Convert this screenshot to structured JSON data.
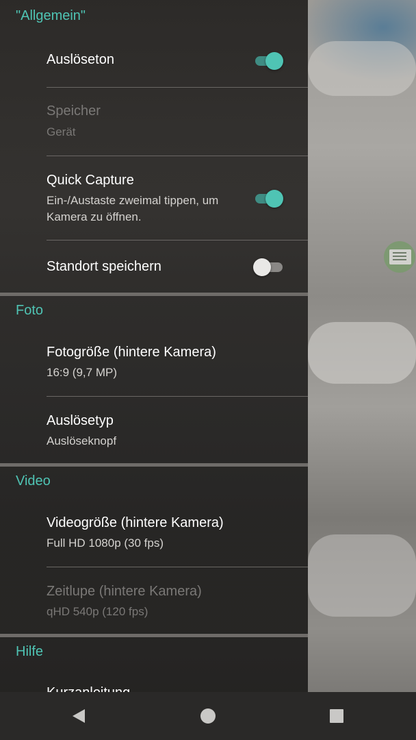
{
  "sections": {
    "general": "\"Allgemein\"",
    "photo": "Foto",
    "video": "Video",
    "help": "Hilfe"
  },
  "items": {
    "shutter_sound": {
      "title": "Auslöseton",
      "toggle": "on"
    },
    "storage": {
      "title": "Speicher",
      "subtitle": "Gerät",
      "enabled": false
    },
    "quick_capture": {
      "title": "Quick Capture",
      "subtitle": "Ein-/Austaste zweimal tippen, um Kamera zu öffnen.",
      "toggle": "on"
    },
    "save_location": {
      "title": "Standort speichern",
      "toggle": "off"
    },
    "photo_size": {
      "title": "Fotogröße (hintere Kamera)",
      "subtitle": "16:9 (9,7 MP)"
    },
    "shutter_type": {
      "title": "Auslösetyp",
      "subtitle": "Auslöseknopf"
    },
    "video_size": {
      "title": "Videogröße (hintere Kamera)",
      "subtitle": "Full HD 1080p (30 fps)"
    },
    "slow_motion": {
      "title": "Zeitlupe (hintere Kamera)",
      "subtitle": "qHD 540p (120 fps)",
      "enabled": false
    },
    "quick_guide": {
      "title": "Kurzanleitung"
    }
  },
  "colors": {
    "accent": "#4fc4b4",
    "panel": "#2c2a28"
  },
  "icons": {
    "side": "document-icon",
    "nav": [
      "back-icon",
      "home-icon",
      "recents-icon"
    ]
  }
}
